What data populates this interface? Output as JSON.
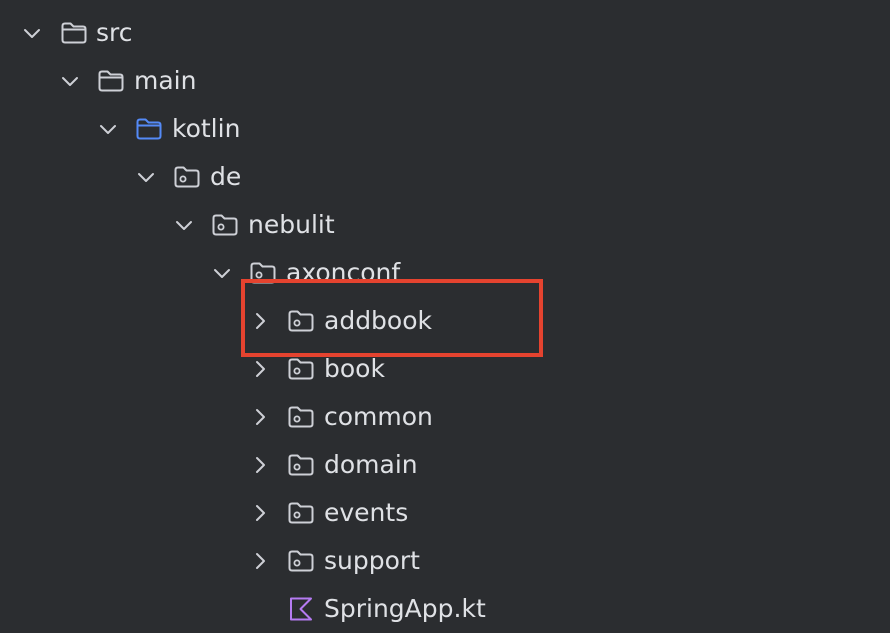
{
  "tree": {
    "items": [
      {
        "label": "src",
        "expanded": true,
        "icon": "folder-icon"
      },
      {
        "label": "main",
        "expanded": true,
        "icon": "folder-icon"
      },
      {
        "label": "kotlin",
        "expanded": true,
        "icon": "source-root-folder-icon"
      },
      {
        "label": "de",
        "expanded": true,
        "icon": "package-folder-icon"
      },
      {
        "label": "nebulit",
        "expanded": true,
        "icon": "package-folder-icon"
      },
      {
        "label": "axonconf",
        "expanded": true,
        "icon": "package-folder-icon"
      },
      {
        "label": "addbook",
        "expanded": false,
        "icon": "package-folder-icon"
      },
      {
        "label": "book",
        "expanded": false,
        "icon": "package-folder-icon"
      },
      {
        "label": "common",
        "expanded": false,
        "icon": "package-folder-icon"
      },
      {
        "label": "domain",
        "expanded": false,
        "icon": "package-folder-icon"
      },
      {
        "label": "events",
        "expanded": false,
        "icon": "package-folder-icon"
      },
      {
        "label": "support",
        "expanded": false,
        "icon": "package-folder-icon"
      },
      {
        "label": "SpringApp.kt",
        "icon": "kotlin-file-icon"
      }
    ]
  },
  "highlighted_item": "addbook",
  "colors": {
    "background": "#2b2d30",
    "text": "#dfe1e5",
    "icon_gray": "#ced0d6",
    "source_root_blue": "#548af7",
    "kotlin_purple": "#b57bf2",
    "highlight_red": "#e5432f"
  }
}
